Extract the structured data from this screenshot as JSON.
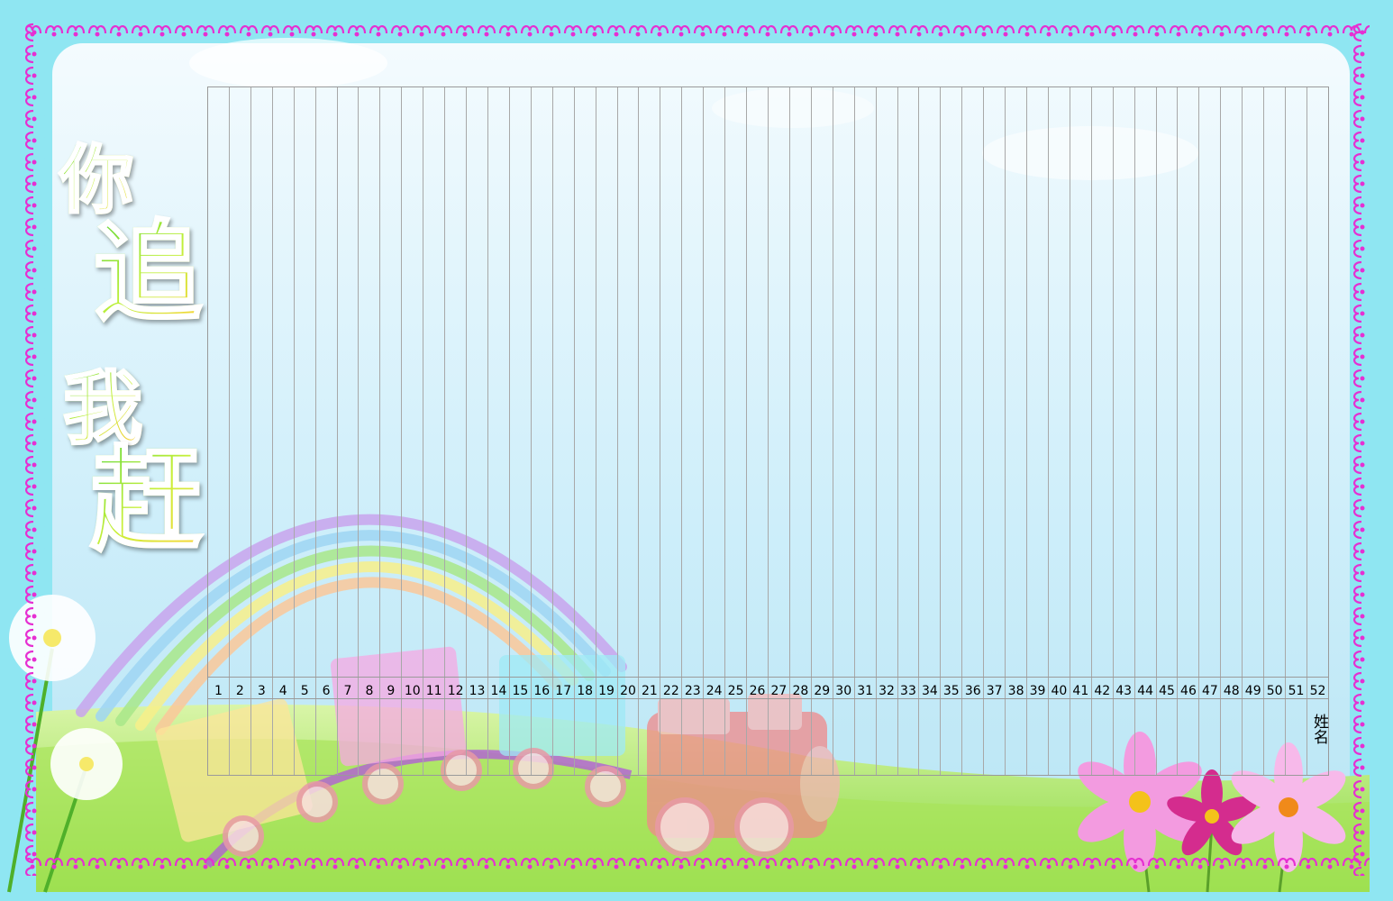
{
  "title": {
    "chars": [
      "你",
      "追",
      "我",
      "赶"
    ]
  },
  "table": {
    "columns": [
      "1",
      "2",
      "3",
      "4",
      "5",
      "6",
      "7",
      "8",
      "9",
      "10",
      "11",
      "12",
      "13",
      "14",
      "15",
      "16",
      "17",
      "18",
      "19",
      "20",
      "21",
      "22",
      "23",
      "24",
      "25",
      "26",
      "27",
      "28",
      "29",
      "30",
      "31",
      "32",
      "33",
      "34",
      "35",
      "36",
      "37",
      "38",
      "39",
      "40",
      "41",
      "42",
      "43",
      "44",
      "45",
      "46",
      "47",
      "48",
      "49",
      "50",
      "51",
      "52"
    ],
    "name_label": "姓名"
  },
  "colors": {
    "frame_ornament": "#e62fd2",
    "outer_bg": "#8fe6f2",
    "sky_top": "#eaf6fb",
    "sky_bottom": "#bfe6f6",
    "grass": "#9be24a"
  }
}
